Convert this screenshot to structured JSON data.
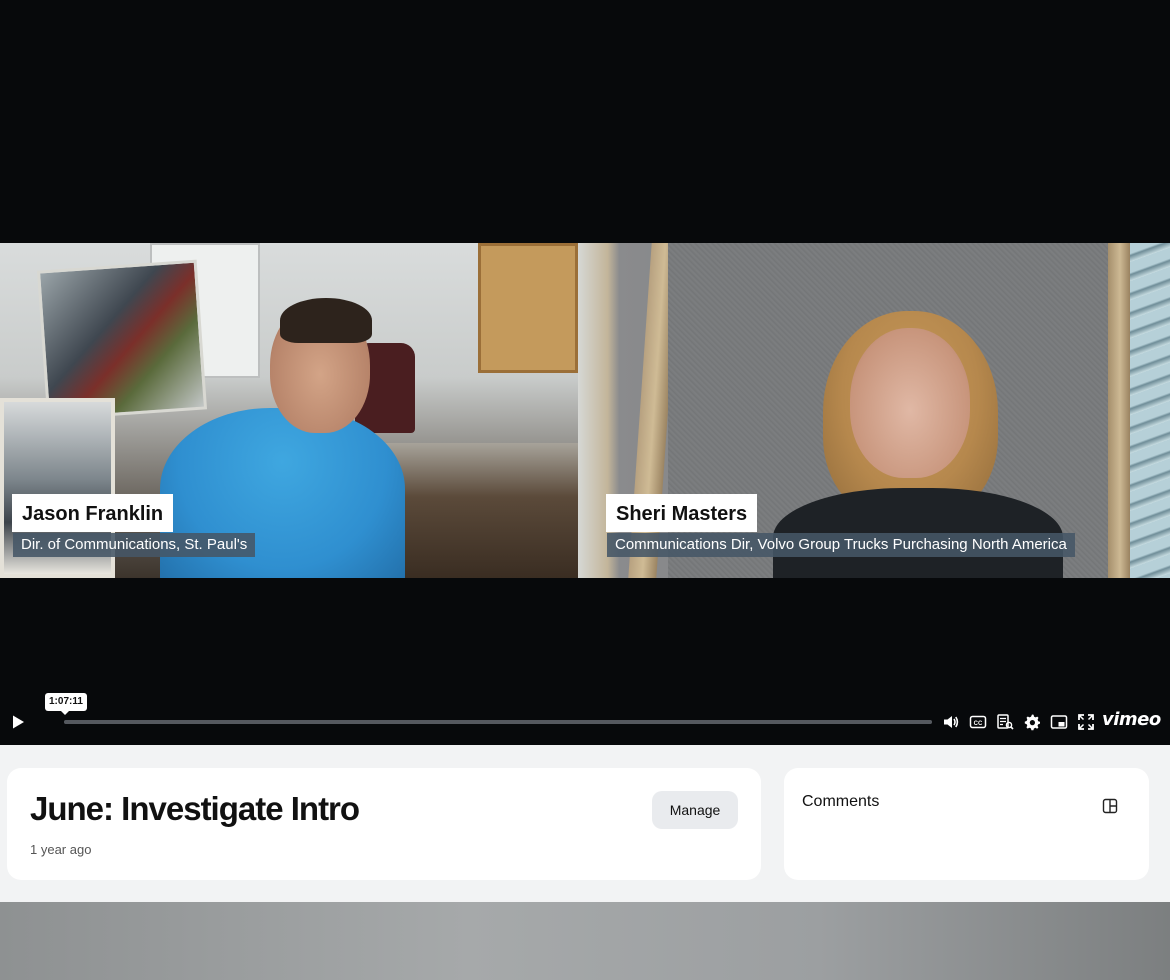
{
  "player": {
    "participants": [
      {
        "name": "Jason Franklin",
        "title": "Dir. of Communications, St. Paul's"
      },
      {
        "name": "Sheri Masters",
        "title": "Communications Dir, Volvo Group Trucks Purchasing North America"
      }
    ],
    "controls": {
      "hover_time": "1:07:11",
      "brand": "vimeo",
      "icons": [
        "play-icon",
        "volume-icon",
        "closed-captions-icon",
        "transcript-icon",
        "settings-icon",
        "picture-in-picture-icon",
        "fullscreen-icon"
      ]
    }
  },
  "video_info": {
    "title": "June: Investigate Intro",
    "age": "1 year ago",
    "manage_label": "Manage"
  },
  "comments": {
    "title": "Comments",
    "toggle_icon": "panel-layout-icon"
  },
  "colors": {
    "player_bg": "#07090b",
    "page_bg": "#f2f3f4",
    "card_bg": "#ffffff",
    "caption_bar": "#465666"
  }
}
